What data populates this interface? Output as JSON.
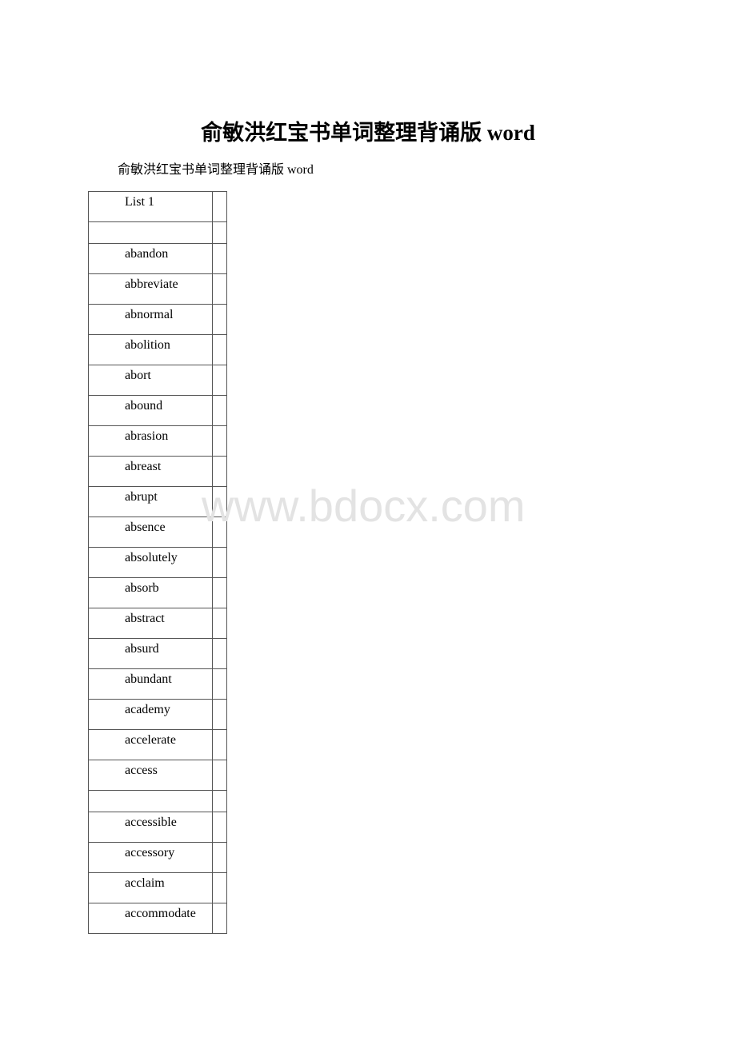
{
  "document": {
    "title": "俞敏洪红宝书单词整理背诵版 word",
    "subtitle": "俞敏洪红宝书单词整理背诵版 word",
    "watermark": "www.bdocx.com"
  },
  "table": {
    "rows": [
      {
        "word": "List 1",
        "tall": true
      },
      {
        "word": "",
        "tall": false
      },
      {
        "word": "abandon",
        "tall": true
      },
      {
        "word": "abbreviate",
        "tall": true
      },
      {
        "word": "abnormal",
        "tall": true
      },
      {
        "word": "abolition",
        "tall": true
      },
      {
        "word": "abort",
        "tall": true
      },
      {
        "word": "abound",
        "tall": true
      },
      {
        "word": "abrasion",
        "tall": true
      },
      {
        "word": "abreast",
        "tall": true
      },
      {
        "word": "abrupt",
        "tall": true
      },
      {
        "word": "absence",
        "tall": true
      },
      {
        "word": "absolutely",
        "tall": true
      },
      {
        "word": "absorb",
        "tall": true
      },
      {
        "word": "abstract",
        "tall": true
      },
      {
        "word": "absurd",
        "tall": true
      },
      {
        "word": "abundant",
        "tall": true
      },
      {
        "word": "academy",
        "tall": true
      },
      {
        "word": "accelerate",
        "tall": true
      },
      {
        "word": "access",
        "tall": true
      },
      {
        "word": "",
        "tall": false
      },
      {
        "word": "accessible",
        "tall": true
      },
      {
        "word": "accessory",
        "tall": true
      },
      {
        "word": "acclaim",
        "tall": true
      },
      {
        "word": "accommodate",
        "tall": true
      }
    ]
  }
}
